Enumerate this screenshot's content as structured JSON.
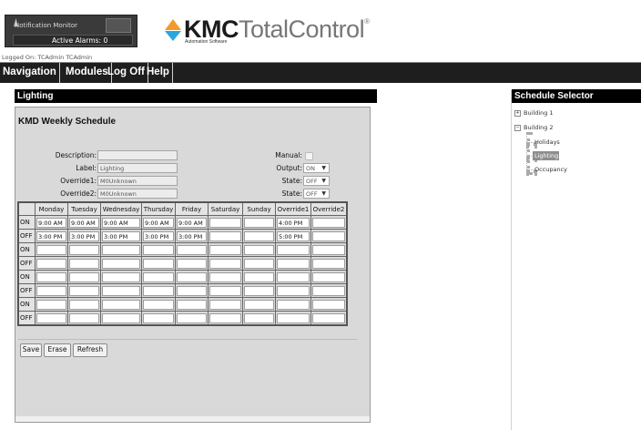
{
  "header": {
    "notification_title": "Notification Monitor",
    "active_alarms": "Active Alarms: 0",
    "logo_kmc": "KMC",
    "logo_total": "TotalControl",
    "logo_reg": "®",
    "logo_sub": "Automation Software",
    "logged_on": "Logged On: TCAdmin TCAdmin"
  },
  "menu": [
    "Navigation",
    "Modules",
    "Log Off",
    "Help"
  ],
  "lighting_panel": {
    "title": "Lighting",
    "schedule_title": "KMD Weekly Schedule",
    "fields": {
      "description_label": "Description:",
      "description_value": "",
      "label_label": "Label:",
      "label_value": "Lighting",
      "override1_label": "Override1:",
      "override1_value": "M0Unknown",
      "override2_label": "Override2:",
      "override2_value": "M0Unknown",
      "manual_label": "Manual:",
      "output_label": "Output:",
      "output_value": "ON",
      "state1_label": "State:",
      "state1_value": "OFF",
      "state2_label": "State:",
      "state2_value": "OFF"
    },
    "columns": [
      "Monday",
      "Tuesday",
      "Wednesday",
      "Thursday",
      "Friday",
      "Saturday",
      "Sunday",
      "Override1",
      "Override2"
    ],
    "rows": [
      {
        "label": "ON",
        "values": [
          "9:00 AM",
          "9:00 AM",
          "9:00 AM",
          "9:00 AM",
          "9:00 AM",
          "",
          "",
          "4:00 PM",
          ""
        ]
      },
      {
        "label": "OFF",
        "values": [
          "3:00 PM",
          "3:00 PM",
          "3:00 PM",
          "3:00 PM",
          "3:00 PM",
          "",
          "",
          "5:00 PM",
          ""
        ]
      },
      {
        "label": "ON",
        "values": [
          "",
          "",
          "",
          "",
          "",
          "",
          "",
          "",
          ""
        ]
      },
      {
        "label": "OFF",
        "values": [
          "",
          "",
          "",
          "",
          "",
          "",
          "",
          "",
          ""
        ]
      },
      {
        "label": "ON",
        "values": [
          "",
          "",
          "",
          "",
          "",
          "",
          "",
          "",
          ""
        ]
      },
      {
        "label": "OFF",
        "values": [
          "",
          "",
          "",
          "",
          "",
          "",
          "",
          "",
          ""
        ]
      },
      {
        "label": "ON",
        "values": [
          "",
          "",
          "",
          "",
          "",
          "",
          "",
          "",
          ""
        ]
      },
      {
        "label": "OFF",
        "values": [
          "",
          "",
          "",
          "",
          "",
          "",
          "",
          "",
          ""
        ]
      }
    ],
    "buttons": {
      "save": "Save",
      "erase": "Erase",
      "refresh": "Refresh"
    }
  },
  "schedule_selector": {
    "title": "Schedule Selector",
    "building1": "Building 1",
    "building2": "Building 2",
    "children": [
      "Holidays",
      "Lighting",
      "Occupancy"
    ],
    "selected": "Lighting"
  },
  "colors": {
    "menubar": "#1e1e1e",
    "panel_bg": "#d9d9d9",
    "logo_orange": "#f39a2b",
    "logo_blue": "#2aa6df",
    "selected_tree": "#8e8e8e"
  }
}
